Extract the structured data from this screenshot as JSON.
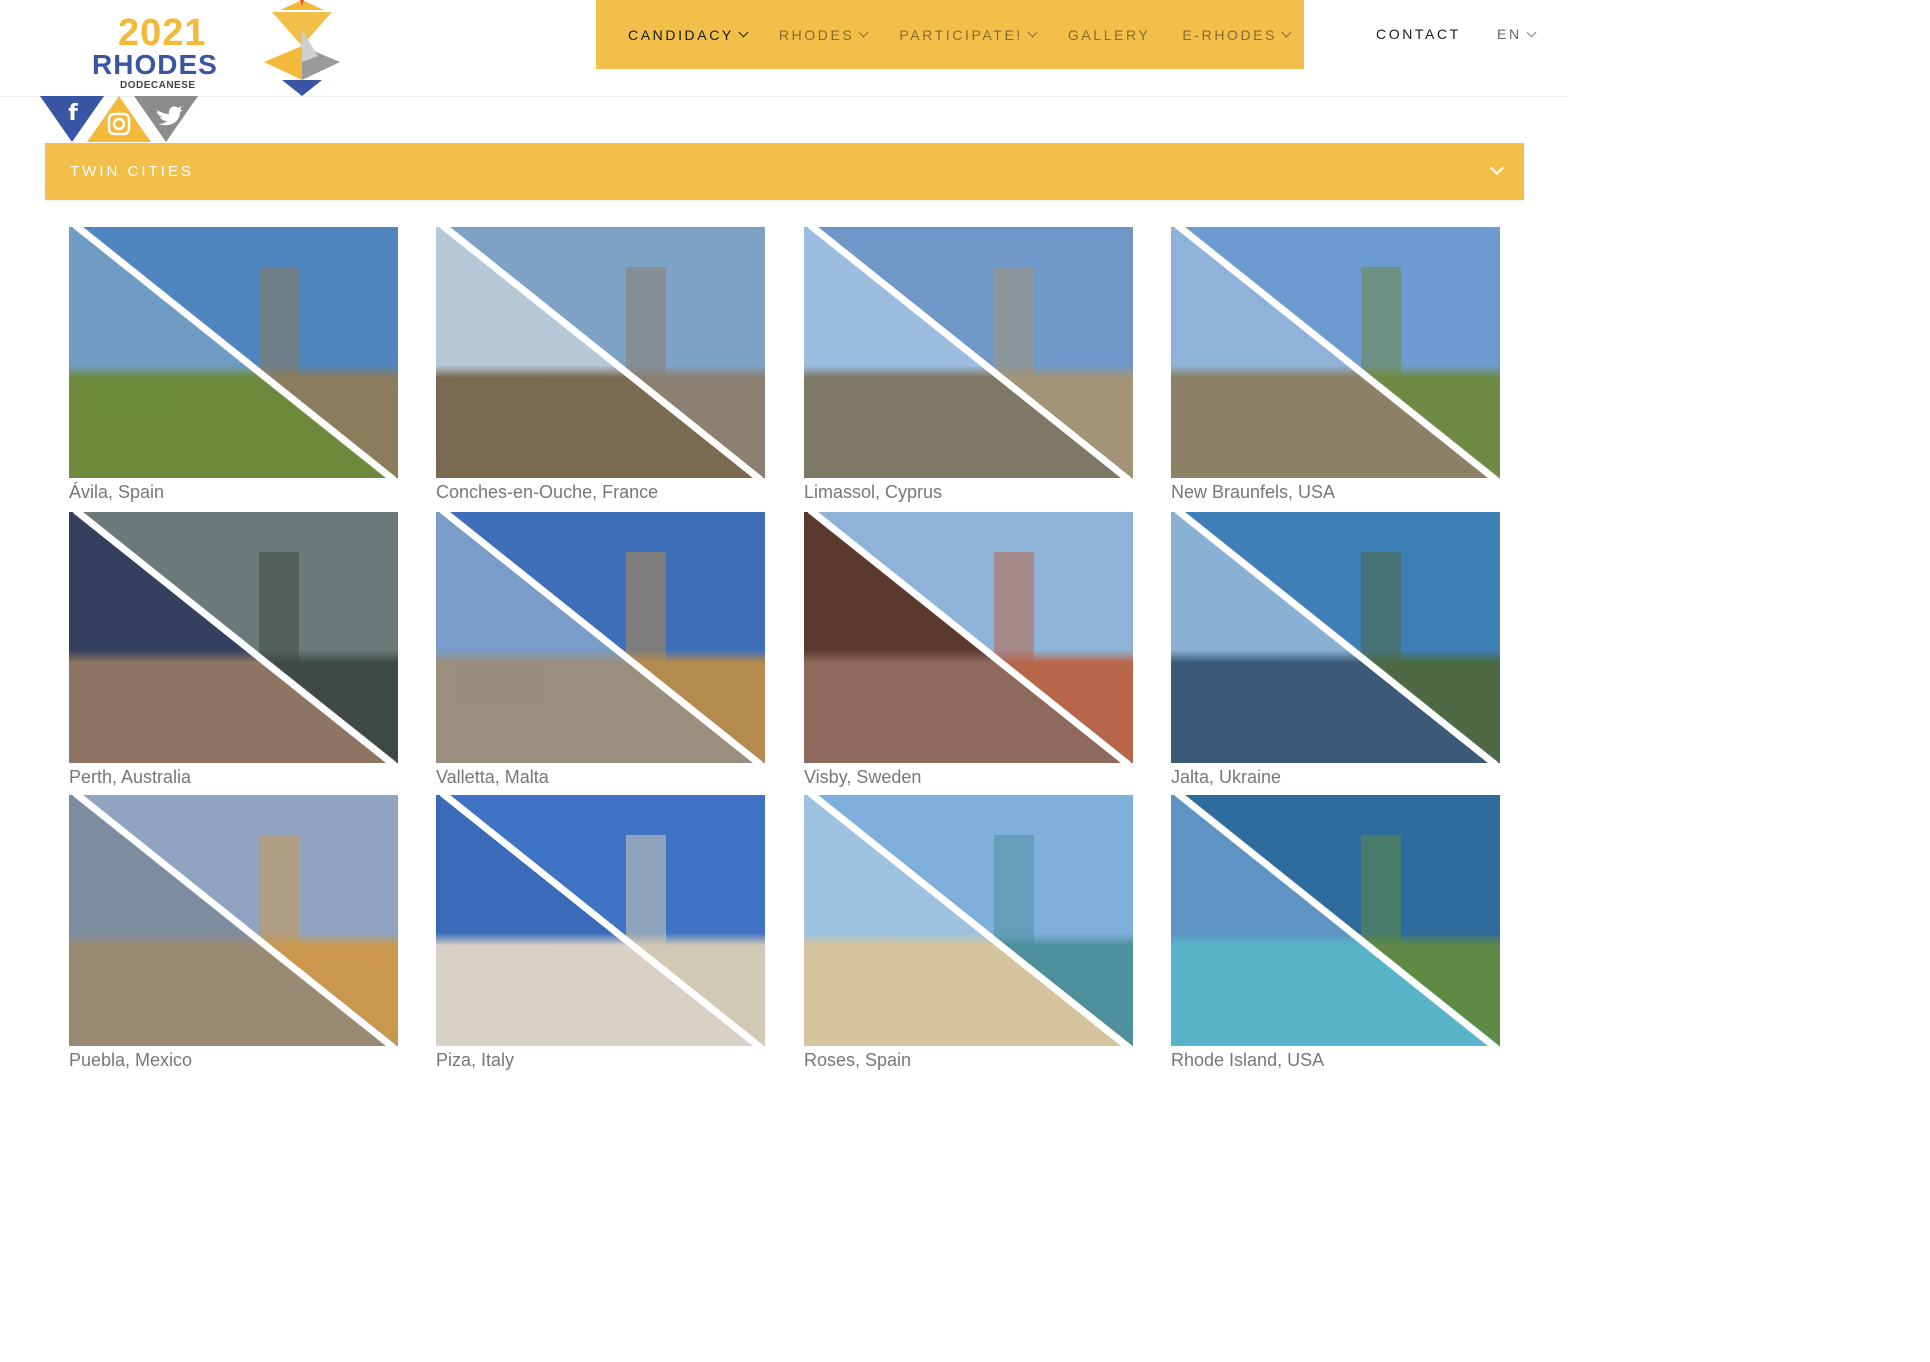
{
  "logo": {
    "year": "2021",
    "city": "RHODES",
    "region": "DODECANESE"
  },
  "social": [
    {
      "icon": "facebook-icon",
      "glyph": "f"
    },
    {
      "icon": "instagram-icon",
      "glyph": ""
    },
    {
      "icon": "twitter-icon",
      "glyph": ""
    }
  ],
  "nav": {
    "items": [
      {
        "label": "CANDIDACY",
        "dropdown": true,
        "active": true
      },
      {
        "label": "RHODES",
        "dropdown": true,
        "active": false
      },
      {
        "label": "PARTICIPATE!",
        "dropdown": true,
        "active": false
      },
      {
        "label": "GALLERY",
        "dropdown": false,
        "active": false
      },
      {
        "label": "E-RHODES",
        "dropdown": true,
        "active": false
      }
    ],
    "contact": "CONTACT",
    "language": "EN"
  },
  "section": {
    "title": "TWIN CITIES"
  },
  "colors": {
    "accent": "#f2c04a",
    "brand_blue": "#3a55a4",
    "caption": "#777777"
  },
  "cities": [
    {
      "caption": "Ávila, Spain",
      "left": {
        "sky": "#6f9cc4",
        "ground": "#6d8a3c"
      },
      "right": {
        "sky": "#4f86c0",
        "ground": "#8a7c5c"
      }
    },
    {
      "caption": "Conches-en-Ouche, France",
      "left": {
        "sky": "#b7c9d9",
        "ground": "#7a6a52"
      },
      "right": {
        "sky": "#7ea2c6",
        "ground": "#8c8072"
      }
    },
    {
      "caption": "Limassol, Cyprus",
      "left": {
        "sky": "#9dbde0",
        "ground": "#7e7866"
      },
      "right": {
        "sky": "#6f98c8",
        "ground": "#a39478"
      }
    },
    {
      "caption": "New Braunfels, USA",
      "left": {
        "sky": "#8fb3d8",
        "ground": "#8c8066"
      },
      "right": {
        "sky": "#6c9bd0",
        "ground": "#6f8a44"
      }
    },
    {
      "caption": "Perth, Australia",
      "left": {
        "sky": "#34405e",
        "ground": "#8e7462"
      },
      "right": {
        "sky": "#6b7a78",
        "ground": "#3f4a46"
      }
    },
    {
      "caption": "Valletta, Malta",
      "left": {
        "sky": "#7a9cc8",
        "ground": "#9a8e7c"
      },
      "right": {
        "sky": "#3f6fb8",
        "ground": "#b58a4e"
      }
    },
    {
      "caption": "Visby, Sweden",
      "left": {
        "sky": "#5b3a2e",
        "ground": "#8e6a5c"
      },
      "right": {
        "sky": "#8fb3d8",
        "ground": "#b8664a"
      }
    },
    {
      "caption": "Jalta, Ukraine",
      "left": {
        "sky": "#8ab0d4",
        "ground": "#3c5a78"
      },
      "right": {
        "sky": "#3f7fb8",
        "ground": "#4d6a44"
      }
    },
    {
      "caption": "Puebla, Mexico",
      "left": {
        "sky": "#7d8da0",
        "ground": "#9a8a74"
      },
      "right": {
        "sky": "#8fa4c0",
        "ground": "#c9984e"
      }
    },
    {
      "caption": "Piza, Italy",
      "left": {
        "sky": "#3a6ab8",
        "ground": "#d8d2c6"
      },
      "right": {
        "sky": "#3f73c4",
        "ground": "#d2c9b4"
      }
    },
    {
      "caption": "Roses, Spain",
      "left": {
        "sky": "#9cc2e0",
        "ground": "#d4c39c"
      },
      "right": {
        "sky": "#7fb0dc",
        "ground": "#4e8f9c"
      }
    },
    {
      "caption": "Rhode Island, USA",
      "left": {
        "sky": "#5f93c4",
        "ground": "#58b4c8"
      },
      "right": {
        "sky": "#2d6c9c",
        "ground": "#5f8a44"
      }
    }
  ]
}
